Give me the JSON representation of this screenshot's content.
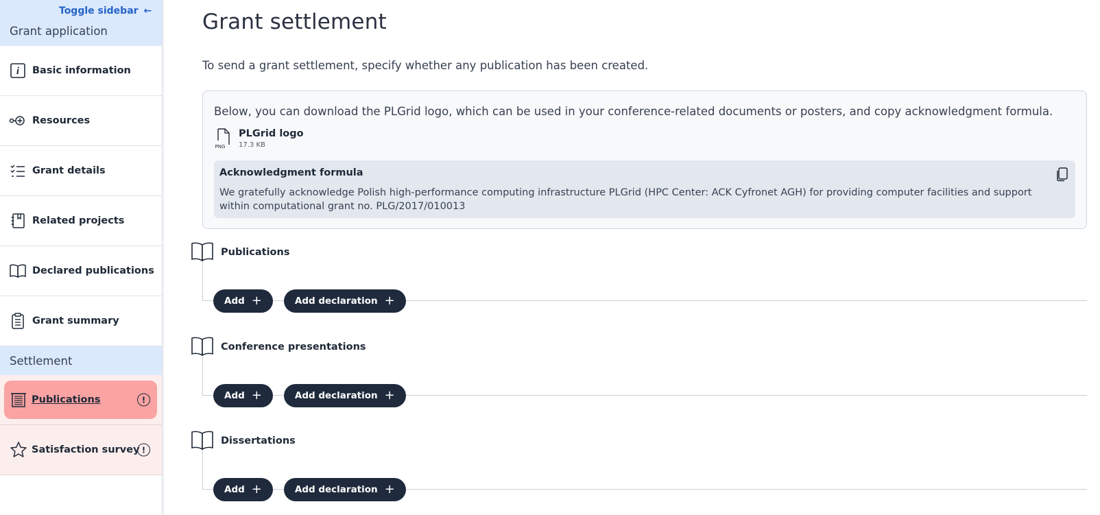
{
  "sidebar": {
    "toggle_label": "Toggle sidebar",
    "section_title": "Grant application",
    "items": [
      {
        "label": "Basic information",
        "icon": "info-icon"
      },
      {
        "label": "Resources",
        "icon": "resources-icon"
      },
      {
        "label": "Grant details",
        "icon": "checklist-icon"
      },
      {
        "label": "Related projects",
        "icon": "notebook-icon"
      },
      {
        "label": "Declared publications",
        "icon": "book-icon"
      },
      {
        "label": "Grant summary",
        "icon": "clipboard-icon"
      }
    ],
    "settlement_title": "Settlement",
    "settlement_items": [
      {
        "label": "Publications",
        "icon": "document-list-icon",
        "active": true,
        "warning": "!"
      },
      {
        "label": "Satisfaction survey",
        "icon": "star-icon",
        "active": false,
        "warning": "!"
      }
    ]
  },
  "main": {
    "title": "Grant settlement",
    "intro": "To send a grant settlement, specify whether any publication has been created.",
    "info": {
      "description": "Below, you can download the PLGrid logo, which can be used in your conference-related documents or posters, and copy acknowledgment formula.",
      "file_name": "PLGrid logo",
      "file_size": "17.3 KB",
      "file_type": "PNG",
      "ack_title": "Acknowledgment formula",
      "ack_text": "We gratefully acknowledge Polish high-performance computing infrastructure PLGrid (HPC Center: ACK Cyfronet AGH) for providing computer facilities and support within computational grant no. PLG/2017/010013"
    },
    "sections": [
      {
        "name": "Publications",
        "add_label": "Add",
        "add_decl_label": "Add declaration"
      },
      {
        "name": "Conference presentations",
        "add_label": "Add",
        "add_decl_label": "Add declaration"
      },
      {
        "name": "Dissertations",
        "add_label": "Add",
        "add_decl_label": "Add declaration"
      }
    ]
  },
  "colors": {
    "accent": "#2563c9",
    "header_bg": "#dbe9fc",
    "active_bg": "#f9a3a3",
    "button_bg": "#1f2a3c"
  }
}
